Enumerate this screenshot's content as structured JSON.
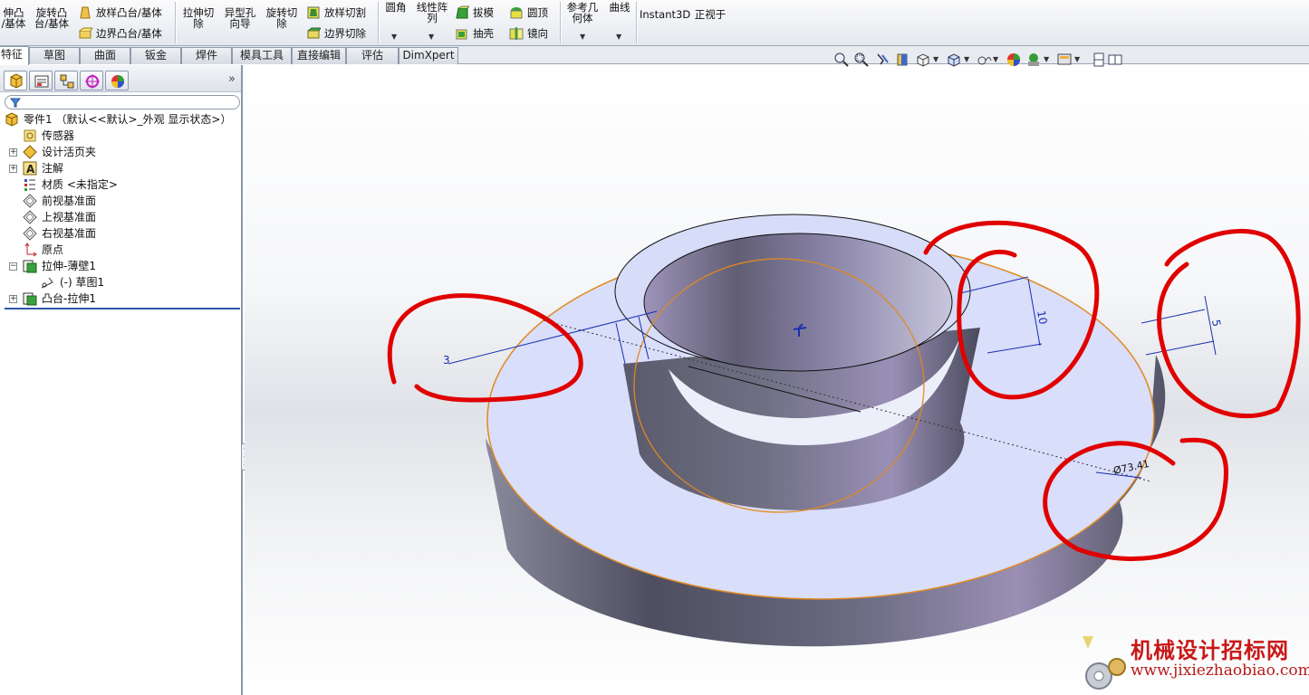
{
  "ribbon": {
    "extrude_boss_label": "伸凸\n/基体",
    "revolve_boss_label": "旋转凸\n台/基体",
    "loft_boss_label": "放样凸台/基体",
    "boundary_boss_label": "边界凸台/基体",
    "extrude_cut_label": "拉伸切\n除",
    "hole_wizard_label": "异型孔\n向导",
    "revolve_cut_label": "旋转切\n除",
    "loft_cut_label": "放样切割",
    "boundary_cut_label": "边界切除",
    "fillet_label": "圆角",
    "linear_pattern_label": "线性阵\n列",
    "draft_label": "拔模",
    "shell_label": "抽壳",
    "dome_label": "圆顶",
    "mirror_label": "镜向",
    "ref_geometry_label": "参考几\n何体",
    "curves_label": "曲线",
    "instant3d_label": "Instant3D",
    "normal_to_label": "正视于"
  },
  "tabs": [
    "特征",
    "草图",
    "曲面",
    "钣金",
    "焊件",
    "模具工具",
    "直接编辑",
    "评估",
    "DimXpert"
  ],
  "tree": {
    "part": "零件1  （默认<<默认>_外观 显示状态>）",
    "sensors": "传感器",
    "design_binder": "设计活页夹",
    "annotations": "注解",
    "material": "材质 <未指定>",
    "front_plane": "前视基准面",
    "top_plane": "上视基准面",
    "right_plane": "右视基准面",
    "origin": "原点",
    "extrude_thin": "拉伸-薄壁1",
    "sketch": "(-) 草图1",
    "boss_extrude": "凸台-拉伸1"
  },
  "model": {
    "dim_height_inner": "10",
    "dim_height_outer": "5",
    "dim_thickness": "3",
    "dim_diameter": "Ø73.41"
  },
  "watermark": {
    "title": "机械设计招标网",
    "url": "www.jixiezhaobiao.com"
  },
  "colors": {
    "face_top": "#d9defa",
    "face_side": "#6b6b80",
    "edge_highlight": "#e08a20",
    "dimension": "#1a2fb0",
    "annotation": "#e00000"
  }
}
